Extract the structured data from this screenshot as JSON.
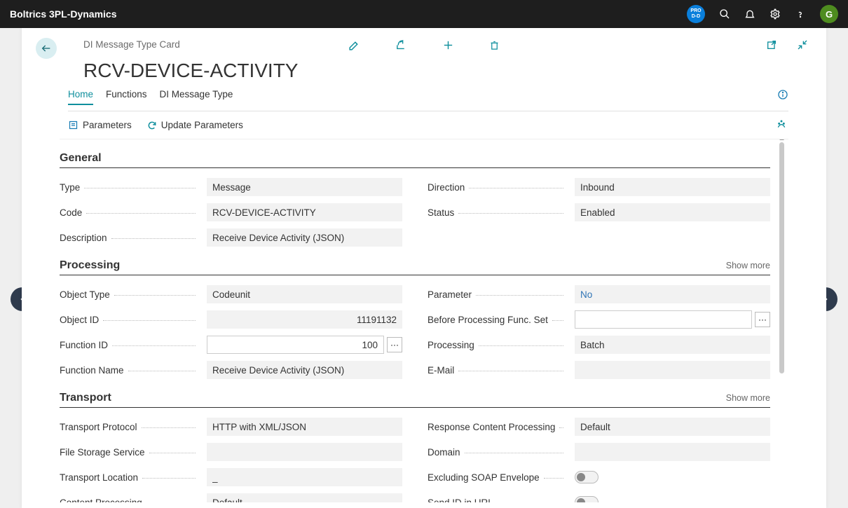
{
  "topbar": {
    "app_name": "Boltrics 3PL-Dynamics",
    "env_line1": "PRO",
    "env_line2": "D-D",
    "avatar_initial": "G"
  },
  "card": {
    "subtitle": "DI Message Type Card",
    "title": "RCV-DEVICE-ACTIVITY"
  },
  "tabs": {
    "home": "Home",
    "functions": "Functions",
    "dimsg": "DI Message Type"
  },
  "subbar": {
    "parameters": "Parameters",
    "update_parameters": "Update Parameters"
  },
  "sections": {
    "general": {
      "title": "General",
      "type_label": "Type",
      "type_value": "Message",
      "code_label": "Code",
      "code_value": "RCV-DEVICE-ACTIVITY",
      "description_label": "Description",
      "description_value": "Receive Device Activity (JSON)",
      "direction_label": "Direction",
      "direction_value": "Inbound",
      "status_label": "Status",
      "status_value": "Enabled"
    },
    "processing": {
      "title": "Processing",
      "show_more": "Show more",
      "object_type_label": "Object Type",
      "object_type_value": "Codeunit",
      "object_id_label": "Object ID",
      "object_id_value": "11191132",
      "function_id_label": "Function ID",
      "function_id_value": "100",
      "function_name_label": "Function Name",
      "function_name_value": "Receive Device Activity (JSON)",
      "parameter_label": "Parameter",
      "parameter_value": "No",
      "before_proc_label": "Before Processing Func. Set",
      "before_proc_value": "",
      "processing_label": "Processing",
      "processing_value": "Batch",
      "email_label": "E-Mail",
      "email_value": ""
    },
    "transport": {
      "title": "Transport",
      "show_more": "Show more",
      "protocol_label": "Transport Protocol",
      "protocol_value": "HTTP with XML/JSON",
      "storage_label": "File Storage Service",
      "storage_value": "",
      "location_label": "Transport Location",
      "location_value": "_",
      "content_proc_label": "Content Processing",
      "content_proc_value": "Default",
      "resp_content_label": "Response Content Processing",
      "resp_content_value": "Default",
      "domain_label": "Domain",
      "domain_value": "",
      "excl_soap_label": "Excluding SOAP Envelope",
      "sendid_label": "Send ID in URL"
    }
  },
  "misc": {
    "ellipsis": "···"
  }
}
